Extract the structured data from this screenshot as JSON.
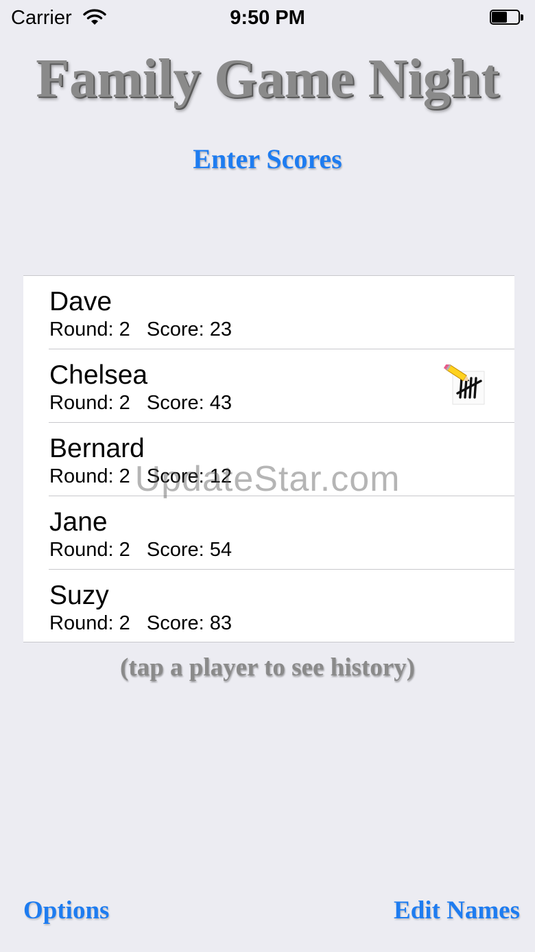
{
  "status_bar": {
    "carrier": "Carrier",
    "time": "9:50 PM",
    "wifi_icon": "wifi-icon",
    "battery_icon": "battery-icon",
    "battery_level": 0.5
  },
  "app_title": "Family Game Night",
  "enter_scores_label": "Enter Scores",
  "players": [
    {
      "name": "Dave",
      "stats": "Round: 2   Score: 23"
    },
    {
      "name": "Chelsea",
      "stats": "Round: 2   Score: 43",
      "icon": "pencil-tally-icon"
    },
    {
      "name": "Bernard",
      "stats": "Round: 2   Score: 12"
    },
    {
      "name": "Jane",
      "stats": "Round: 2   Score: 54"
    },
    {
      "name": "Suzy",
      "stats": "Round: 2   Score: 83"
    }
  ],
  "hint": "(tap a player to see history)",
  "watermark": "UpdateStar.com",
  "bottom": {
    "options_label": "Options",
    "edit_names_label": "Edit Names"
  },
  "colors": {
    "accent": "#1e7cf0",
    "background": "#ececf2",
    "title_gray": "#8a8a8a"
  }
}
